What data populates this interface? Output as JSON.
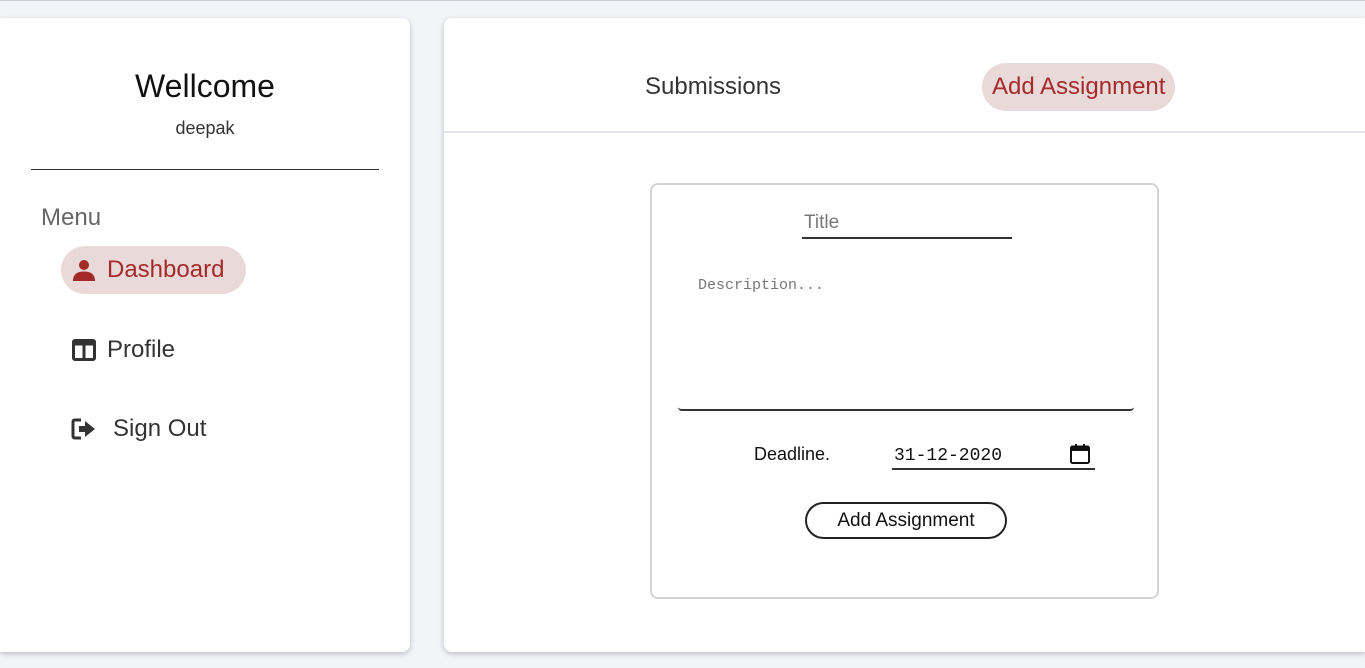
{
  "sidebar": {
    "welcome": "Wellcome",
    "username": "deepak",
    "menu_title": "Menu",
    "items": [
      {
        "label": "Dashboard",
        "icon": "user-icon",
        "active": true
      },
      {
        "label": "Profile",
        "icon": "layout-panel-icon",
        "active": false
      },
      {
        "label": "Sign Out",
        "icon": "sign-out-icon",
        "active": false
      }
    ]
  },
  "tabs": [
    {
      "label": "Submissions",
      "active": false
    },
    {
      "label": "Add Assignment",
      "active": true
    }
  ],
  "form": {
    "title_placeholder": "Title",
    "title_value": "",
    "description_placeholder": "Description...",
    "description_value": "",
    "deadline_label": "Deadline.",
    "deadline_value": "31-12-2020",
    "submit_label": "Add Assignment"
  },
  "colors": {
    "accent": "#a52a2a",
    "active_bg": "#ead9d9",
    "page_bg": "#f3f4f8"
  }
}
